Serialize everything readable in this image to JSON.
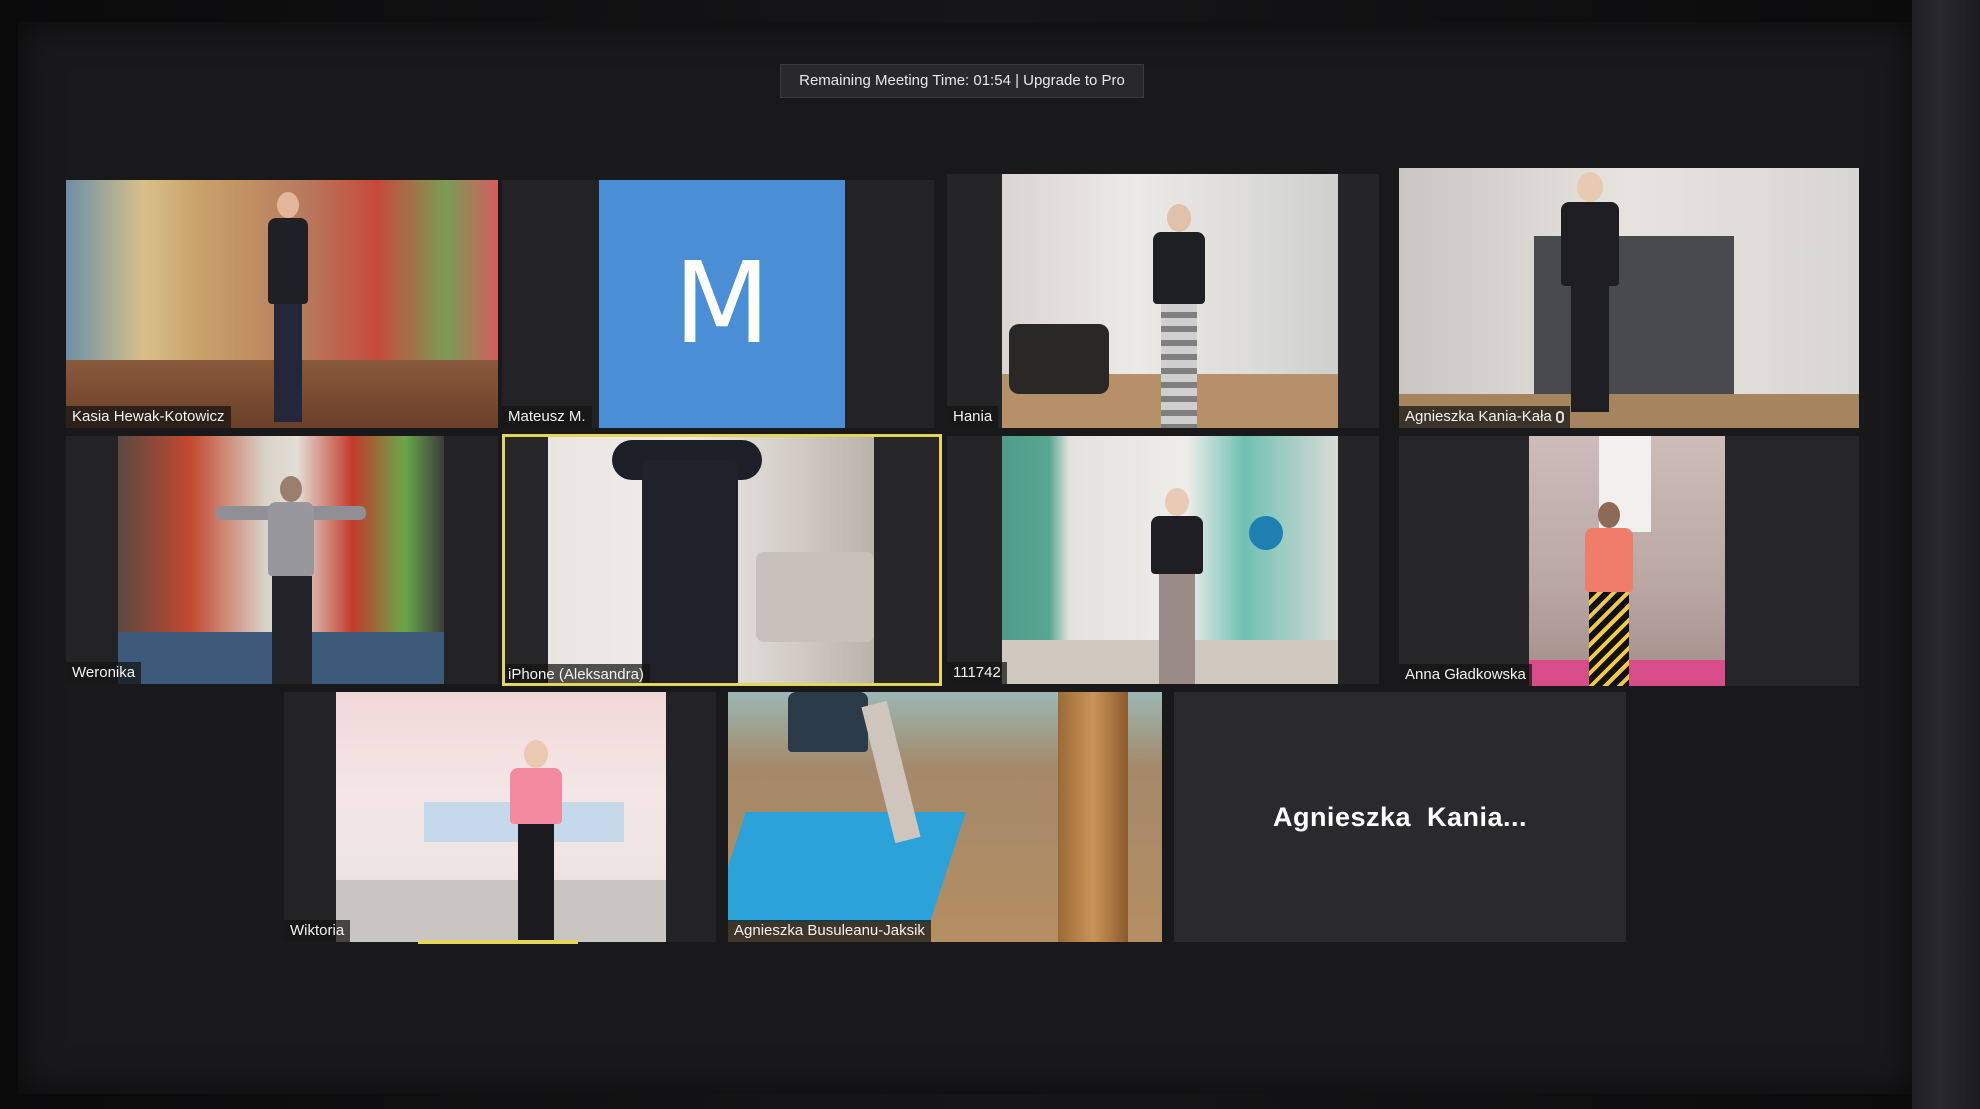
{
  "meeting": {
    "banner_text": "Remaining Meeting Time: 01:54 | Upgrade to Pro"
  },
  "participants": [
    {
      "name": "Kasia Hewak-Kotowicz",
      "video": true
    },
    {
      "name": "Mateusz M.",
      "video": false,
      "avatar_letter": "M"
    },
    {
      "name": "Hania",
      "video": true
    },
    {
      "name": "Agnieszka Kania-Kała",
      "video": true,
      "muted_icon": "mic-icon"
    },
    {
      "name": "Weronika",
      "video": true
    },
    {
      "name": "iPhone (Aleksandra)",
      "video": true,
      "active_speaker": true
    },
    {
      "name": "111742",
      "video": true
    },
    {
      "name": "Anna Gładkowska",
      "video": true
    },
    {
      "name": "Wiktoria",
      "video": true
    },
    {
      "name": "Agnieszka Busuleanu-Jaksik",
      "video": true
    },
    {
      "name": "Agnieszka  Kania...",
      "video": false
    }
  ],
  "colors": {
    "avatar_blue": "#4a8fd6",
    "active_border": "#e3d65a",
    "screen_bg": "#19191b"
  }
}
